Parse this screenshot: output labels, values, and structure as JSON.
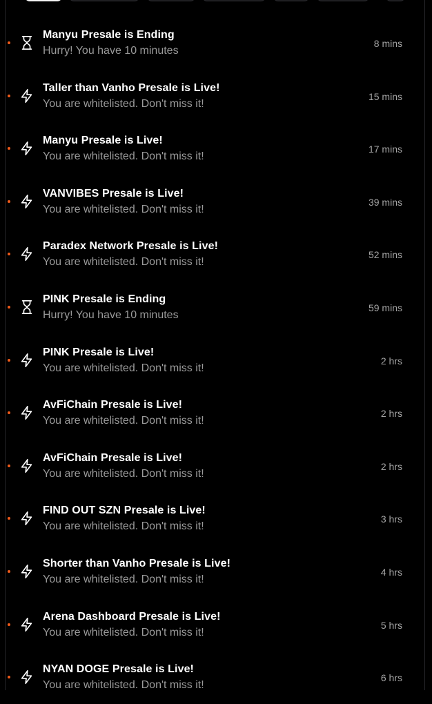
{
  "filters": {
    "tabs": [
      {
        "id": "tab-1",
        "active": true
      },
      {
        "id": "tab-2",
        "active": false
      },
      {
        "id": "tab-3",
        "active": false
      },
      {
        "id": "tab-4",
        "active": false
      },
      {
        "id": "tab-5",
        "active": false
      },
      {
        "id": "tab-6",
        "active": false
      },
      {
        "id": "tab-7",
        "active": false
      }
    ]
  },
  "colors": {
    "unread_dot": "#f05a1a",
    "title": "#ffffff",
    "subtitle": "#9a9a9a",
    "background": "#000000"
  },
  "notifications": [
    {
      "icon": "hourglass-icon",
      "title": "Manyu Presale is Ending",
      "subtitle": "Hurry! You have 10 minutes",
      "time": "8 mins",
      "unread": true
    },
    {
      "icon": "lightning-icon",
      "title": "Taller than Vanho Presale is Live!",
      "subtitle": "You are whitelisted. Don't miss it!",
      "time": "15 mins",
      "unread": true
    },
    {
      "icon": "lightning-icon",
      "title": "Manyu Presale is Live!",
      "subtitle": "You are whitelisted. Don't miss it!",
      "time": "17 mins",
      "unread": true
    },
    {
      "icon": "lightning-icon",
      "title": "VANVIBES Presale is Live!",
      "subtitle": "You are whitelisted. Don't miss it!",
      "time": "39 mins",
      "unread": true
    },
    {
      "icon": "lightning-icon",
      "title": "Paradex Network Presale is Live!",
      "subtitle": "You are whitelisted. Don't miss it!",
      "time": "52 mins",
      "unread": true
    },
    {
      "icon": "hourglass-icon",
      "title": "PINK Presale is Ending",
      "subtitle": "Hurry! You have 10 minutes",
      "time": "59 mins",
      "unread": true
    },
    {
      "icon": "lightning-icon",
      "title": "PINK Presale is Live!",
      "subtitle": "You are whitelisted. Don't miss it!",
      "time": "2 hrs",
      "unread": true
    },
    {
      "icon": "lightning-icon",
      "title": "AvFiChain Presale is Live!",
      "subtitle": "You are whitelisted. Don't miss it!",
      "time": "2 hrs",
      "unread": true
    },
    {
      "icon": "lightning-icon",
      "title": "AvFiChain Presale is Live!",
      "subtitle": "You are whitelisted. Don't miss it!",
      "time": "2 hrs",
      "unread": true
    },
    {
      "icon": "lightning-icon",
      "title": "FIND OUT SZN Presale is Live!",
      "subtitle": "You are whitelisted. Don't miss it!",
      "time": "3 hrs",
      "unread": true
    },
    {
      "icon": "lightning-icon",
      "title": "Shorter than Vanho Presale is Live!",
      "subtitle": "You are whitelisted. Don't miss it!",
      "time": "4 hrs",
      "unread": true
    },
    {
      "icon": "lightning-icon",
      "title": "Arena Dashboard Presale is Live!",
      "subtitle": "You are whitelisted. Don't miss it!",
      "time": "5 hrs",
      "unread": true
    },
    {
      "icon": "lightning-icon",
      "title": "NYAN DOGE Presale is Live!",
      "subtitle": "You are whitelisted. Don't miss it!",
      "time": "6 hrs",
      "unread": true
    }
  ]
}
